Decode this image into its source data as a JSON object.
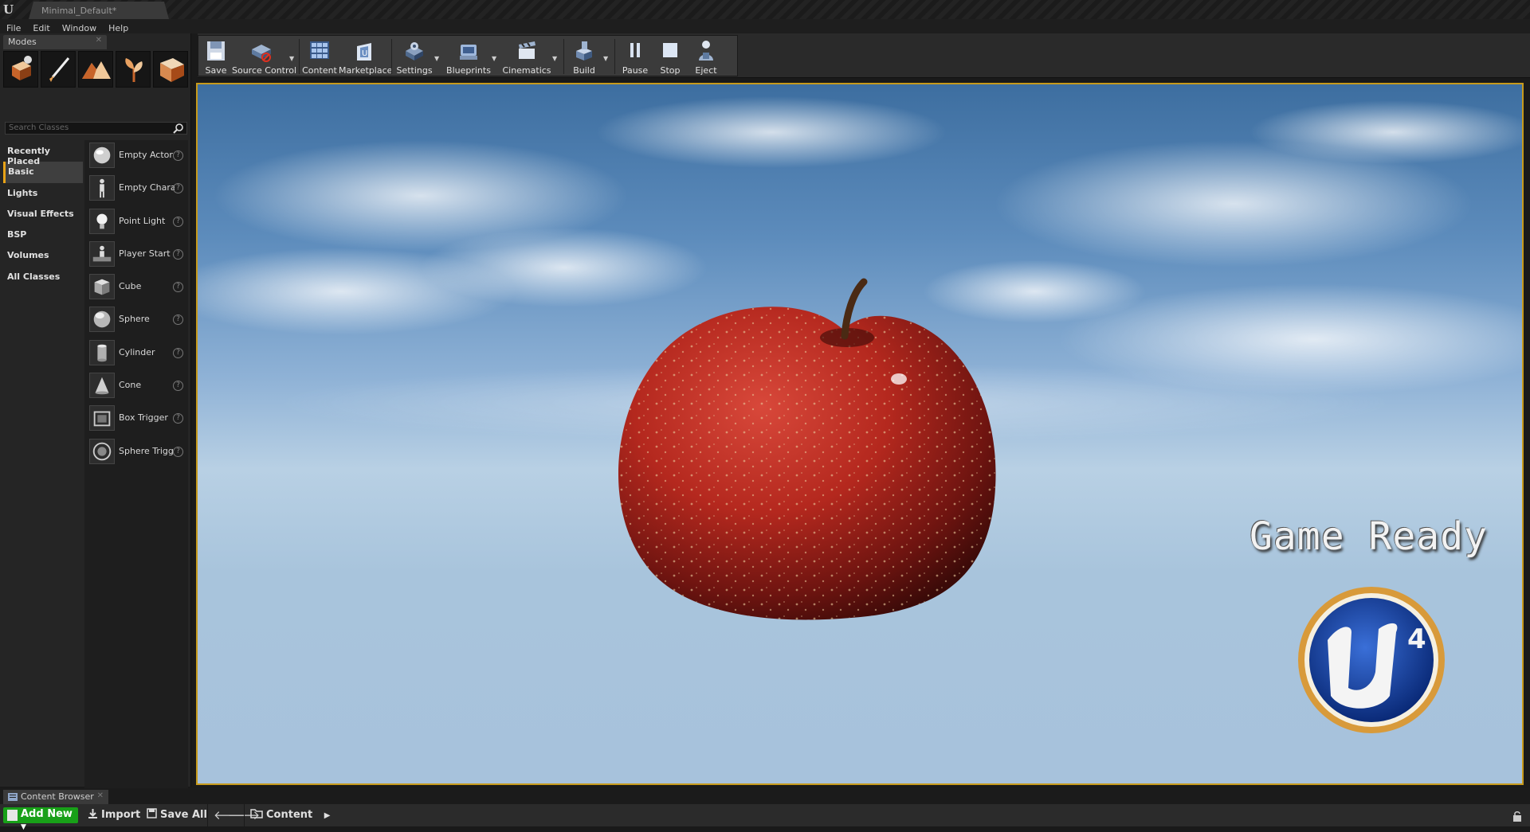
{
  "window": {
    "tab_title": "Minimal_Default*"
  },
  "menu": [
    "File",
    "Edit",
    "Window",
    "Help"
  ],
  "modes_panel": {
    "tab_label": "Modes",
    "mode_icons": [
      "place-mode-icon",
      "paint-mode-icon",
      "landscape-mode-icon",
      "foliage-mode-icon",
      "geometry-mode-icon"
    ],
    "search_placeholder": "Search Classes",
    "categories": [
      "Recently Placed",
      "Basic",
      "Lights",
      "Visual Effects",
      "BSP",
      "Volumes",
      "All Classes"
    ],
    "active_category": "Basic",
    "classes": [
      "Empty Actor",
      "Empty Chara",
      "Point Light",
      "Player Start",
      "Cube",
      "Sphere",
      "Cylinder",
      "Cone",
      "Box Trigger",
      "Sphere Trigg"
    ]
  },
  "toolbar": {
    "buttons": [
      "Save",
      "Source Control",
      "Content",
      "Marketplace",
      "Settings",
      "Blueprints",
      "Cinematics",
      "Build",
      "Pause",
      "Stop",
      "Eject"
    ]
  },
  "viewport": {
    "overlay_text": "Game Ready",
    "logo_text": "4",
    "border_color": "#c79a1c"
  },
  "content_browser": {
    "tab_label": "Content Browser",
    "add_new": "Add New",
    "import": "Import",
    "save_all": "Save All",
    "path": "Content",
    "accent_color": "#18a018"
  }
}
